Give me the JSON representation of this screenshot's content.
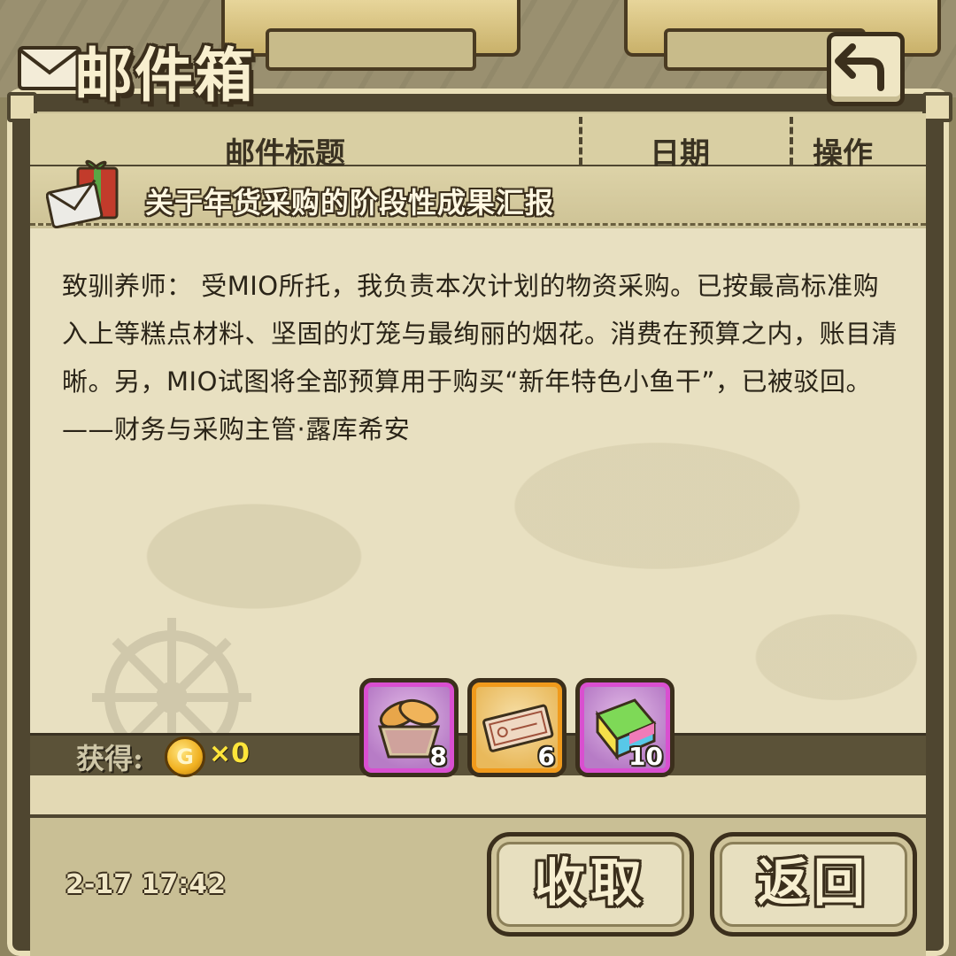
{
  "header": {
    "title": "邮件箱"
  },
  "columns": {
    "title": "邮件标题",
    "date": "日期",
    "action": "操作"
  },
  "mail": {
    "subject": "关于年货采购的阶段性成果汇报",
    "body": "致驯养师： 受MIO所托，我负责本次计划的物资采购。已按最高标准购入上等糕点材料、坚固的灯笼与最绚丽的烟花。消费在预算之内，账目清晰。另，MIO试图将全部预算用于购买“新年特色小鱼干”，已被驳回。——财务与采购主管·露库希安",
    "date": "2-17 17:42"
  },
  "rewards": {
    "gain_label": "获得:",
    "coin_icon": "gold-coin-icon",
    "coin_letter": "G",
    "coin_count": "×0",
    "items": [
      {
        "icon": "bread-basket-icon",
        "count": "8",
        "rarity": "purple"
      },
      {
        "icon": "ticket-icon",
        "count": "6",
        "rarity": "orange"
      },
      {
        "icon": "colorful-book-icon",
        "count": "10",
        "rarity": "purple"
      }
    ]
  },
  "buttons": {
    "claim": "收取",
    "back": "返回"
  },
  "colors": {
    "frame": "#4f4630",
    "paper": "#e8e0c1",
    "coin_count": "#ffe53a",
    "purple_border": "#d94fd0",
    "orange_border": "#f09a1c"
  }
}
